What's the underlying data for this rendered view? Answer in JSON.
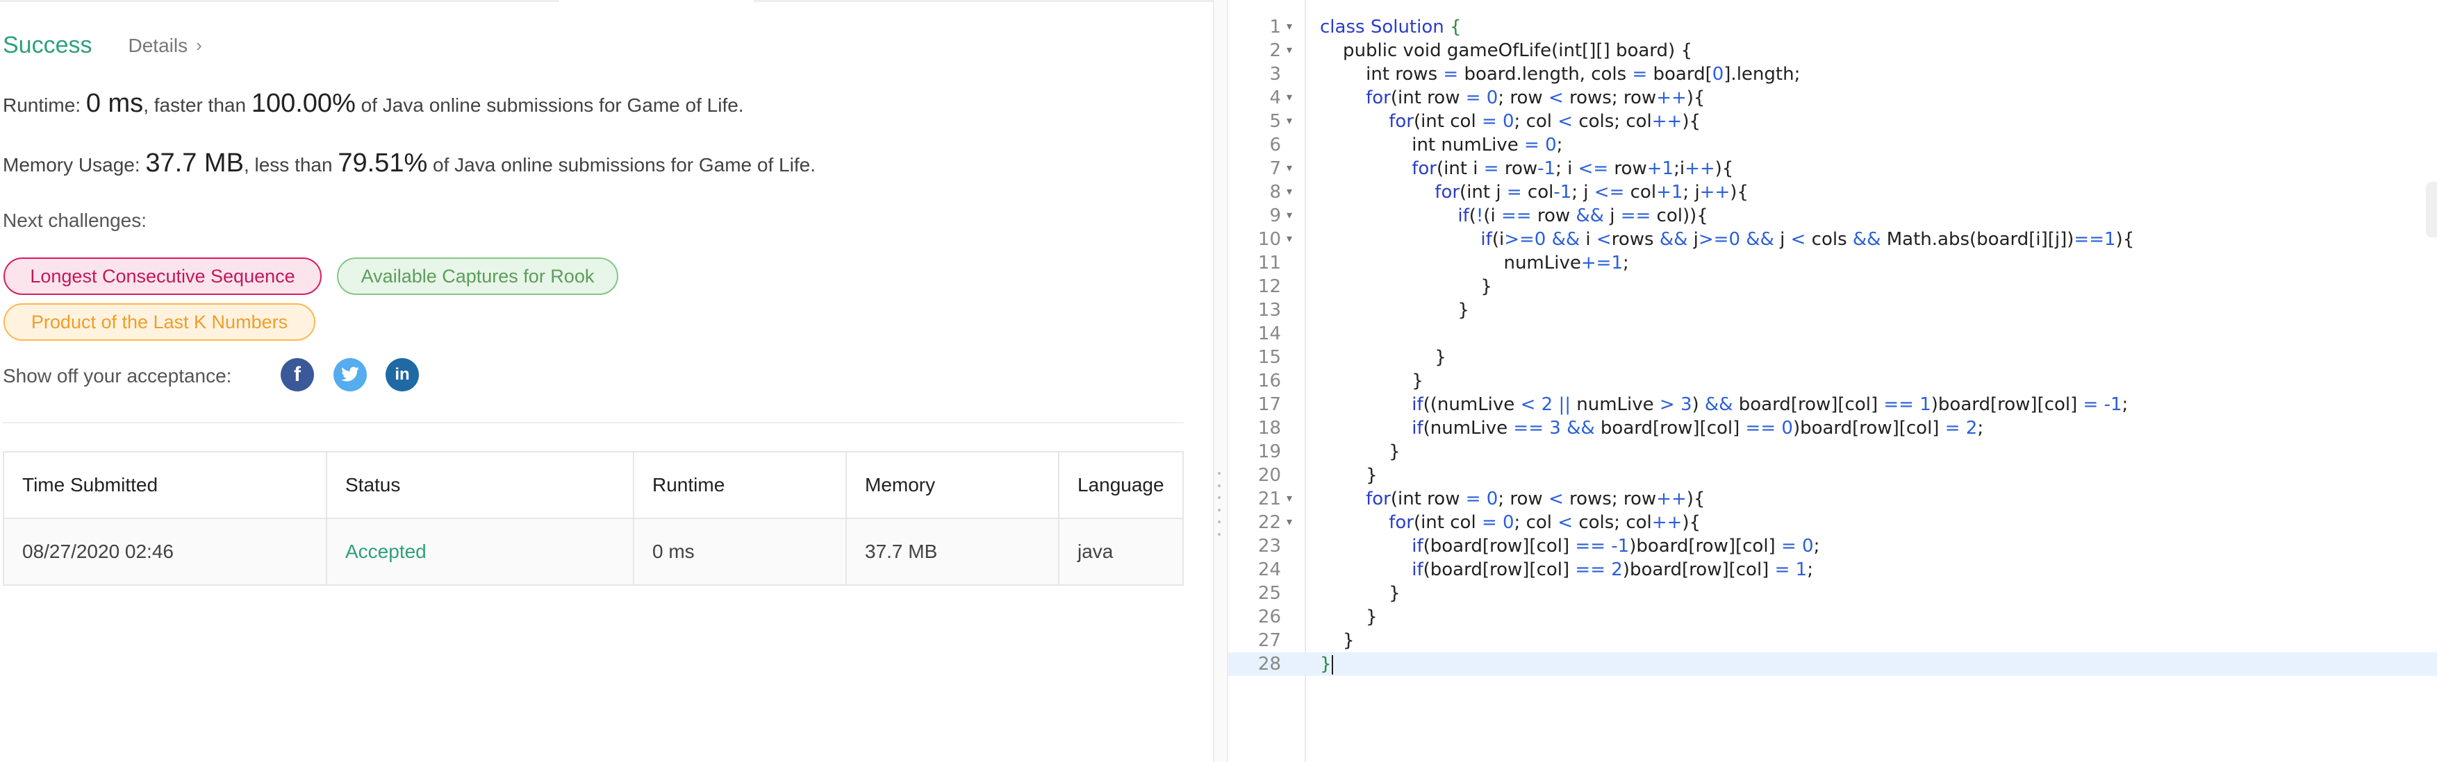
{
  "result": {
    "status": "Success",
    "details_link": "Details",
    "runtime": {
      "label": "Runtime:",
      "value": "0 ms",
      "mid": ", faster than",
      "percent": "100.00%",
      "suffix": "of Java online submissions for Game of Life."
    },
    "memory": {
      "label": "Memory Usage:",
      "value": "37.7 MB",
      "mid": ", less than",
      "percent": "79.51%",
      "suffix": "of Java online submissions for Game of Life."
    }
  },
  "challenges": {
    "label": "Next challenges:",
    "items": [
      "Longest Consecutive Sequence",
      "Available Captures for Rook",
      "Product of the Last K Numbers"
    ]
  },
  "share": {
    "label": "Show off your acceptance:",
    "icons": [
      "facebook-icon",
      "twitter-icon",
      "linkedin-icon"
    ]
  },
  "submissions": {
    "headers": [
      "Time Submitted",
      "Status",
      "Runtime",
      "Memory",
      "Language"
    ],
    "rows": [
      [
        "08/27/2020 02:46",
        "Accepted",
        "0 ms",
        "37.7 MB",
        "java"
      ]
    ]
  },
  "code": {
    "folded_lines": [
      1,
      2,
      4,
      5,
      7,
      8,
      9,
      10,
      21,
      22
    ],
    "active_line": 28,
    "lines": [
      "class Solution {",
      "    public void gameOfLife(int[][] board) {",
      "        int rows = board.length, cols = board[0].length;",
      "        for(int row = 0; row < rows; row++){",
      "            for(int col = 0; col < cols; col++){",
      "                int numLive = 0;",
      "                for(int i = row-1; i <= row+1;i++){",
      "                    for(int j = col-1; j <= col+1; j++){",
      "                        if(!(i == row && j == col)){",
      "                            if(i>=0 && i <rows && j>=0 && j < cols && Math.abs(board[i][j])==1){",
      "                                numLive+=1;",
      "                            }",
      "                        }",
      "",
      "                    }",
      "                }",
      "                if((numLive < 2 || numLive > 3) && board[row][col] == 1)board[row][col] = -1;",
      "                if(numLive == 3 && board[row][col] == 0)board[row][col] = 2;",
      "            }",
      "        }",
      "        for(int row = 0; row < rows; row++){",
      "            for(int col = 0; col < cols; col++){",
      "                if(board[row][col] == -1)board[row][col] = 0;",
      "                if(board[row][col] == 2)board[row][col] = 1;",
      "            }",
      "        }",
      "    }",
      "}"
    ]
  }
}
